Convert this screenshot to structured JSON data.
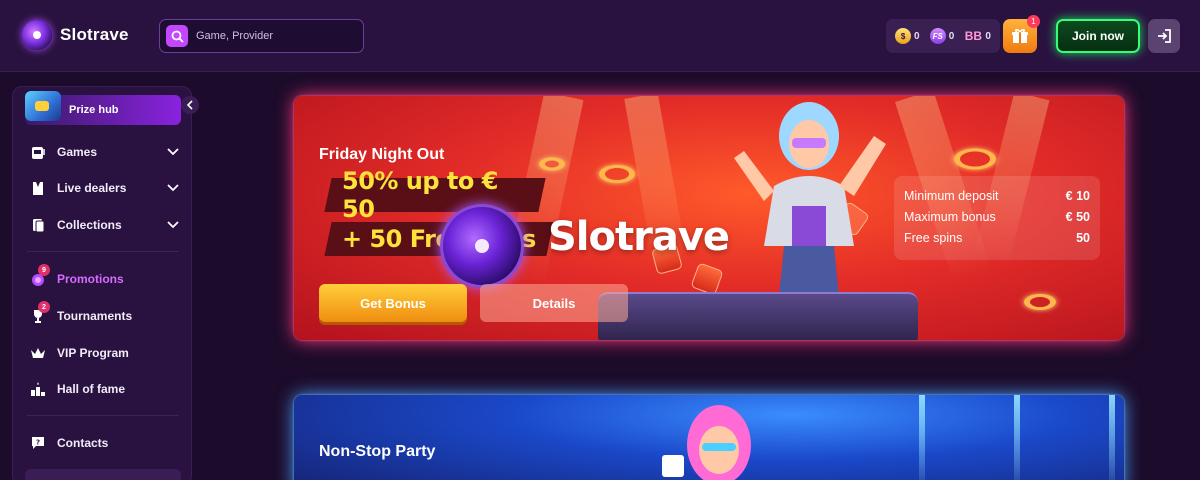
{
  "header": {
    "logo_text": "Slotrave",
    "search": {
      "placeholder": "Game, Provider"
    },
    "balances": [
      {
        "icon": "gold-coin-icon",
        "value": "0"
      },
      {
        "icon": "free-spins-icon",
        "value": "0"
      },
      {
        "icon": "bonus-balance-icon",
        "value": "0"
      }
    ],
    "gift_badge": "1",
    "join_label": "Join now"
  },
  "sidebar": {
    "prize_hub_label": "Prize hub",
    "items": [
      {
        "label": "Games",
        "icon": "slot-machine-icon",
        "expandable": true
      },
      {
        "label": "Live dealers",
        "icon": "dealer-icon",
        "expandable": true
      },
      {
        "label": "Collections",
        "icon": "cards-icon",
        "expandable": true
      },
      {
        "label": "Promotions",
        "icon": "promotions-icon",
        "badge": "9",
        "active": true
      },
      {
        "label": "Tournaments",
        "icon": "trophy-icon",
        "badge": "2"
      },
      {
        "label": "VIP Program",
        "icon": "crown-icon"
      },
      {
        "label": "Hall of fame",
        "icon": "podium-icon"
      },
      {
        "label": "Contacts",
        "icon": "chat-icon"
      }
    ]
  },
  "banners": [
    {
      "title": "Friday Night Out",
      "offer_line1": "50% up to € 50",
      "offer_line2": "+ 50 Free Spins",
      "offer_line2_visible": "+ 50 Fre",
      "offer_line2_tail": "s",
      "brand": "Slotrave",
      "bonus_button": "Get Bonus",
      "details_button": "Details",
      "info": [
        {
          "label": "Minimum deposit",
          "value": "€ 10"
        },
        {
          "label": "Maximum bonus",
          "value": "€ 50"
        },
        {
          "label": "Free spins",
          "value": "50"
        }
      ]
    },
    {
      "title": "Non-Stop Party"
    }
  ],
  "colors": {
    "accent_purple": "#c247ff",
    "join_green": "#33ff77",
    "bonus_orange": "#f08d10",
    "banner1_red": "#e32c28",
    "banner2_blue": "#1a48c8"
  }
}
